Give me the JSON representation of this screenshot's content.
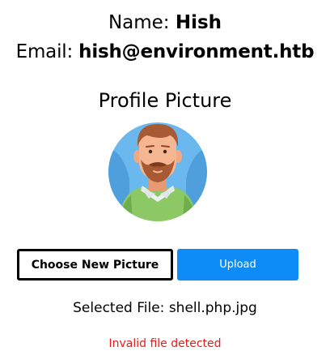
{
  "profile": {
    "name_label": "Name:",
    "name_value": "Hish",
    "email_label": "Email:",
    "email_value": "hish@environment.htb"
  },
  "picture": {
    "title": "Profile Picture",
    "avatar_icon": "bearded-man-avatar-icon",
    "avatar_bg_color": "#6ab8ee"
  },
  "actions": {
    "choose_label": "Choose New Picture",
    "upload_label": "Upload",
    "upload_color": "#0d8bf7"
  },
  "status": {
    "selected_label": "Selected File:",
    "selected_file": "shell.php.jpg",
    "error_message": "Invalid file detected",
    "error_color": "#e21b1b"
  }
}
